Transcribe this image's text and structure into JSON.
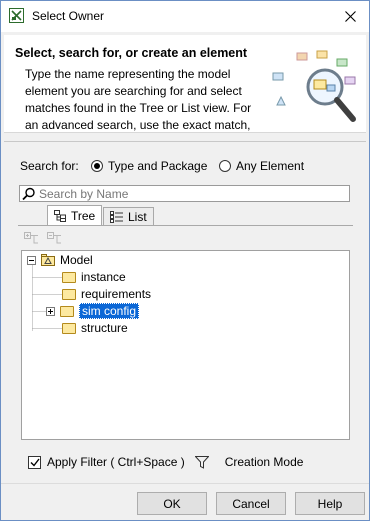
{
  "window": {
    "title": "Select Owner"
  },
  "header": {
    "title": "Select, search for, or create an element",
    "description": "Type the name representing the model element you are searching for and select matches found in the Tree or List view. For an advanced search, use the exact match,"
  },
  "search_for": {
    "label": "Search for:",
    "options": [
      {
        "label": "Type and Package",
        "selected": true
      },
      {
        "label": "Any Element",
        "selected": false
      }
    ]
  },
  "search": {
    "placeholder": "Search by Name"
  },
  "tabs": [
    {
      "label": "Tree",
      "active": true
    },
    {
      "label": "List",
      "active": false
    }
  ],
  "tree": {
    "root": "Model",
    "children": [
      {
        "label": "instance",
        "expandable": false,
        "selected": false
      },
      {
        "label": "requirements",
        "expandable": false,
        "selected": false
      },
      {
        "label": "sim config",
        "expandable": true,
        "selected": true
      },
      {
        "label": "structure",
        "expandable": false,
        "selected": false
      }
    ]
  },
  "filter": {
    "apply_label": "Apply Filter ( Ctrl+Space )",
    "checked": true,
    "creation_mode_label": "Creation Mode"
  },
  "buttons": {
    "ok": "OK",
    "cancel": "Cancel",
    "help": "Help"
  }
}
